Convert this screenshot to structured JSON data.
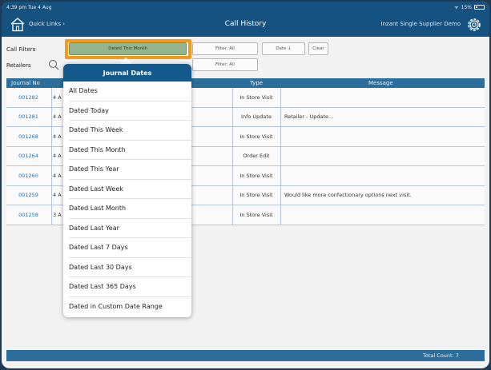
{
  "status_bar": {
    "time": "4:39 pm  Tue 4 Aug",
    "battery": "15%"
  },
  "nav": {
    "quick_links": "Quick Links ›",
    "title": "Call History",
    "app_name": "Inzant Single Supplier Demo"
  },
  "filters": {
    "call_filters_label": "Call Filters",
    "retailers_label": "Retailers",
    "dated_button": "Dated This Month",
    "filter_all_1": "Filter: All",
    "filter_all_2": "Filter: All",
    "date_sort": "Date ↓",
    "clear": "Clear"
  },
  "table": {
    "headers": {
      "journal_no": "Journal No",
      "type": "Type",
      "message": "Message"
    },
    "rows": [
      {
        "journal_no": "001282",
        "date": "4 A",
        "type": "In Store Visit",
        "message": ""
      },
      {
        "journal_no": "001281",
        "date": "4 A",
        "type": "Info Update",
        "message": "Retailer - Update..."
      },
      {
        "journal_no": "001268",
        "date": "4 A",
        "type": "In Store Visit",
        "message": ""
      },
      {
        "journal_no": "001264",
        "date": "4 A",
        "type": "Order Edit",
        "message": ""
      },
      {
        "journal_no": "001260",
        "date": "4 A",
        "type": "In Store Visit",
        "message": ""
      },
      {
        "journal_no": "001259",
        "date": "4 A",
        "type": "In Store Visit",
        "message": "Would like more confectionary options next visit."
      },
      {
        "journal_no": "001258",
        "date": "3 A",
        "type": "In Store Visit",
        "message": ""
      }
    ]
  },
  "footer": {
    "total_count": "Total Count: 7"
  },
  "popover": {
    "title": "Journal Dates",
    "options": [
      "All Dates",
      "Dated Today",
      "Dated This Week",
      "Dated This Month",
      "Dated This Year",
      "Dated Last Week",
      "Dated Last Month",
      "Dated Last Year",
      "Dated Last 7 Days",
      "Dated Last 30 Days",
      "Dated Last 365 Days",
      "Dated in Custom Date Range"
    ]
  },
  "colors": {
    "nav": "#15527f",
    "header": "#2b6e9c",
    "highlight": "#f29a1a",
    "active_button": "#93b48c"
  }
}
